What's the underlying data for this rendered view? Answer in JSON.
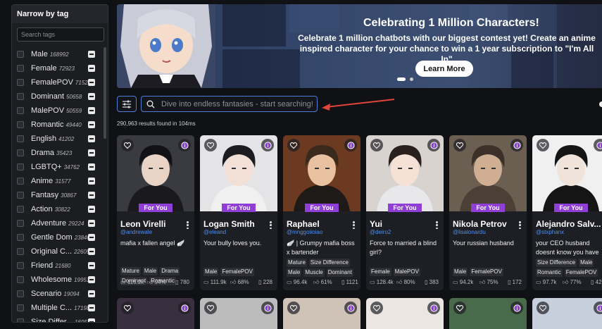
{
  "sidebar": {
    "title": "Narrow by tag",
    "search_placeholder": "Search tags",
    "tags": [
      {
        "name": "Male",
        "count": "168992"
      },
      {
        "name": "Female",
        "count": "72923"
      },
      {
        "name": "FemalePOV",
        "count": "71524"
      },
      {
        "name": "Dominant",
        "count": "50658"
      },
      {
        "name": "MalePOV",
        "count": "50559"
      },
      {
        "name": "Romantic",
        "count": "49440"
      },
      {
        "name": "English",
        "count": "41202"
      },
      {
        "name": "Drama",
        "count": "35423"
      },
      {
        "name": "LGBTQ+",
        "count": "34762"
      },
      {
        "name": "Anime",
        "count": "31577"
      },
      {
        "name": "Fantasy",
        "count": "30867"
      },
      {
        "name": "Action",
        "count": "30822"
      },
      {
        "name": "Adventure",
        "count": "29224"
      },
      {
        "name": "Gentle Dom",
        "count": "23846"
      },
      {
        "name": "Original C...",
        "count": "22605"
      },
      {
        "name": "Friend",
        "count": "21680"
      },
      {
        "name": "Wholesome",
        "count": "19951"
      },
      {
        "name": "Scenario",
        "count": "19094"
      },
      {
        "name": "Multiple C...",
        "count": "17198"
      },
      {
        "name": "Size Differ...",
        "count": "16957"
      }
    ]
  },
  "banner": {
    "title": "Celebrating 1 Million Characters!",
    "text": "Celebrate 1 million chatbots with our biggest contest yet! Create an anime inspired character for your chance to win a 1 year subscription to \"I'm All In\"",
    "button": "Learn More"
  },
  "search": {
    "placeholder": "Dive into endless fantasies - start searching!",
    "results_text": "290,963 results found in 104ms"
  },
  "colors": {
    "accent": "#8f3fd6",
    "link": "#4f8ee8",
    "focus": "#4f7dd8",
    "arrow": "#e0443a"
  },
  "cards": [
    {
      "badge": "For You",
      "name": "Leon Virelli",
      "handle": "@andrewale",
      "desc": "mafia x fallen angel 🪽",
      "tags": [
        "Mature",
        "Male",
        "Drama",
        "Dominant",
        "Romantic"
      ],
      "chats": "115.2k",
      "rating": "94%",
      "likes": "780"
    },
    {
      "badge": "For You",
      "name": "Logan Smith",
      "handle": "@eleand",
      "desc": "Your bully loves you.",
      "tags": [
        "Male",
        "FemalePOV"
      ],
      "chats": "111.9k",
      "rating": "68%",
      "likes": "228"
    },
    {
      "badge": "For You",
      "name": "Raphael",
      "handle": "@mnggoiioiao",
      "desc": "🪽 | Grumpy mafia boss x bartender",
      "tags": [
        "Mature",
        "Size Difference",
        "Male",
        "Muscle",
        "Dominant"
      ],
      "chats": "96.4k",
      "rating": "61%",
      "likes": "1121"
    },
    {
      "badge": "For You",
      "name": "Yui",
      "handle": "@deiro2",
      "desc": "Force to married a blind girl?",
      "tags": [
        "Female",
        "MalePOV"
      ],
      "chats": "128.4k",
      "rating": "80%",
      "likes": "383"
    },
    {
      "badge": "For You",
      "name": "Nikola Petrov",
      "handle": "@lisalonardu",
      "desc": "Your russian husband",
      "tags": [
        "Male",
        "FemalePOV"
      ],
      "chats": "94.2k",
      "rating": "75%",
      "likes": "172"
    },
    {
      "badge": "For You",
      "name": "Alejandro Salv...",
      "handle": "@stxphanx",
      "desc": "your CEO husband doesnt know you have",
      "tags": [
        "Size Difference",
        "Male",
        "Romantic",
        "FemalePOV"
      ],
      "chats": "97.7k",
      "rating": "77%",
      "likes": "425"
    }
  ]
}
